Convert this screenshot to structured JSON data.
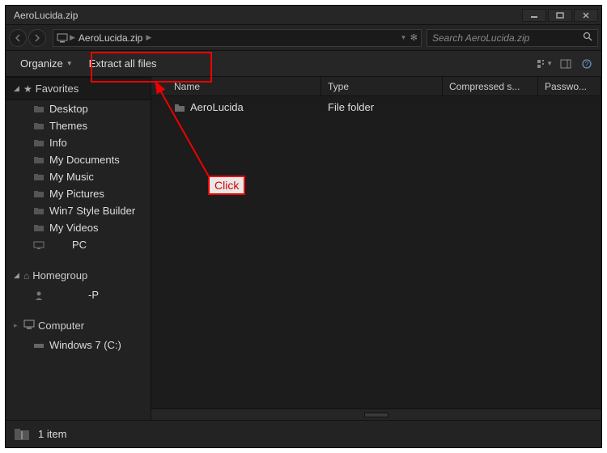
{
  "window": {
    "title": "AeroLucida.zip"
  },
  "nav": {
    "breadcrumb_root_icon": "computer",
    "crumb1": "AeroLucida.zip",
    "search_placeholder": "Search AeroLucida.zip"
  },
  "toolbar": {
    "organize_label": "Organize",
    "extract_label": "Extract all files"
  },
  "sidebar": {
    "favorites_label": "Favorites",
    "favorites": [
      {
        "label": "Desktop"
      },
      {
        "label": "Themes"
      },
      {
        "label": "Info"
      },
      {
        "label": "My Documents"
      },
      {
        "label": "My Music"
      },
      {
        "label": "My Pictures"
      },
      {
        "label": "Win7 Style Builder"
      },
      {
        "label": "My Videos"
      },
      {
        "label": "PC"
      }
    ],
    "homegroup_label": "Homegroup",
    "homegroup_items": [
      {
        "label": "-P"
      }
    ],
    "computer_label": "Computer",
    "computer_items": [
      {
        "label": "Windows 7 (C:)"
      }
    ]
  },
  "columns": {
    "name": "Name",
    "type": "Type",
    "compressed": "Compressed s...",
    "password": "Passwo..."
  },
  "rows": [
    {
      "name": "AeroLucida",
      "type": "File folder"
    }
  ],
  "status": {
    "text": "1 item"
  },
  "annotation": {
    "label": "Click"
  }
}
